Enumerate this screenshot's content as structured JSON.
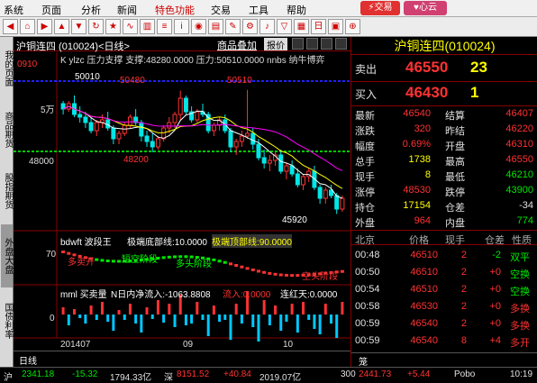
{
  "menu": [
    "系统",
    "页面",
    "分析",
    "新闻",
    "特色功能",
    "交易",
    "工具",
    "帮助"
  ],
  "toolbar": {
    "trade_btn": "交易",
    "phone_btn": "心云"
  },
  "sidetabs": [
    "我的页面",
    "商品期货",
    "股指期货",
    "外盘大盘",
    "国债利率"
  ],
  "chart": {
    "title": "沪铜连四 (010024)<日线>",
    "chip": "商品叠加",
    "report": "报价",
    "indicator_row": "K  ylzc 压力支撑 支撑:48280.0000 压力:50510.0000  nnbs 纳牛博弈",
    "price_labels": [
      "50480",
      "50510",
      "48200",
      "45920",
      "50010"
    ],
    "y_labels": [
      "5万",
      "48000",
      "70",
      "0"
    ],
    "sub1_title": "bdwft 波段王",
    "sub1_a": "极端底部线:10.0000",
    "sub1_b": "极端顶部线:90.0000",
    "sub1_tags": [
      "多卖开",
      "短空阶段",
      "多头阶段",
      "空头阶段"
    ],
    "sub2_title": "mml 买卖量",
    "sub2_a": "N日内净流入:-1063.8808",
    "sub2_b": "流入:0.0000",
    "sub2_c": "连红天:0.0000",
    "x_labels": [
      "201407",
      "09",
      "10"
    ],
    "tab": "日线"
  },
  "chart_data": {
    "type": "candlestick",
    "ylim": [
      45500,
      51500
    ],
    "ohlc": [
      [
        50000,
        50100,
        49600,
        49800
      ],
      [
        49800,
        50100,
        49700,
        50000
      ],
      [
        50000,
        50300,
        49500,
        49600
      ],
      [
        49600,
        49900,
        49300,
        49500
      ],
      [
        49500,
        49700,
        49100,
        49300
      ],
      [
        49300,
        49500,
        48900,
        49000
      ],
      [
        49000,
        49400,
        48800,
        49300
      ],
      [
        49300,
        49600,
        49100,
        49400
      ],
      [
        49400,
        49700,
        49000,
        49100
      ],
      [
        49100,
        49200,
        48500,
        48700
      ],
      [
        48700,
        49000,
        48500,
        48900
      ],
      [
        48900,
        49300,
        48800,
        49200
      ],
      [
        49200,
        49600,
        49100,
        49500
      ],
      [
        49500,
        49800,
        49200,
        49300
      ],
      [
        49300,
        49400,
        48600,
        48800
      ],
      [
        48800,
        49000,
        48400,
        48600
      ],
      [
        48600,
        48900,
        48200,
        48400
      ],
      [
        48400,
        48800,
        48300,
        48700
      ],
      [
        48700,
        49200,
        48600,
        49100
      ],
      [
        49100,
        49500,
        48900,
        49300
      ],
      [
        49300,
        49700,
        49100,
        49600
      ],
      [
        49600,
        50480,
        49400,
        50200
      ],
      [
        50200,
        50300,
        49600,
        49700
      ],
      [
        49700,
        49900,
        49300,
        49400
      ],
      [
        49400,
        49800,
        49300,
        49700
      ],
      [
        49700,
        50000,
        49500,
        49600
      ],
      [
        49600,
        49700,
        48900,
        49000
      ],
      [
        49000,
        49300,
        48800,
        49200
      ],
      [
        49200,
        49500,
        49000,
        49400
      ],
      [
        49400,
        49600,
        48900,
        49000
      ],
      [
        49000,
        49100,
        48200,
        48400
      ],
      [
        48400,
        48700,
        48100,
        48600
      ],
      [
        48600,
        49000,
        48400,
        48800
      ],
      [
        48800,
        50510,
        48700,
        48900
      ],
      [
        48900,
        49100,
        48300,
        48500
      ],
      [
        48500,
        48700,
        47900,
        48000
      ],
      [
        48000,
        48300,
        47600,
        47800
      ],
      [
        47800,
        48100,
        47500,
        47900
      ],
      [
        47900,
        48200,
        47700,
        48100
      ],
      [
        48100,
        48300,
        47400,
        47500
      ],
      [
        47500,
        47800,
        47200,
        47700
      ],
      [
        47700,
        47900,
        47300,
        47400
      ],
      [
        47400,
        47600,
        46900,
        47000
      ],
      [
        47000,
        47400,
        46800,
        47300
      ],
      [
        47300,
        47600,
        47100,
        47500
      ],
      [
        47500,
        47700,
        46800,
        46900
      ],
      [
        46900,
        47000,
        46300,
        46500
      ],
      [
        46500,
        46900,
        46300,
        46800
      ],
      [
        46800,
        47000,
        46500,
        46600
      ],
      [
        46600,
        46700,
        45920,
        46100
      ],
      [
        46100,
        46600,
        46000,
        46500
      ]
    ]
  },
  "panel": {
    "title": "沪铜连四(010024)",
    "ask": {
      "label": "卖出",
      "price": "46550",
      "vol": "23"
    },
    "bid": {
      "label": "买入",
      "price": "46430",
      "vol": "1"
    },
    "stats": [
      [
        "最新",
        "46540",
        "结算",
        "46407"
      ],
      [
        "涨跌",
        "320",
        "昨结",
        "46220"
      ],
      [
        "幅度",
        "0.69%",
        "开盘",
        "46310"
      ],
      [
        "总手",
        "1738",
        "最高",
        "46550"
      ],
      [
        "现手",
        "8",
        "最低",
        "46210"
      ],
      [
        "涨停",
        "48530",
        "跌停",
        "43900"
      ],
      [
        "持仓",
        "17154",
        "仓差",
        "-34"
      ],
      [
        "外盘",
        "964",
        "内盘",
        "774"
      ]
    ],
    "tick_headers": [
      "北京",
      "价格",
      "现手",
      "仓差",
      "性质"
    ],
    "ticks": [
      [
        "00:48",
        "46510",
        "2",
        "-2",
        "双平"
      ],
      [
        "00:50",
        "46510",
        "2",
        "+0",
        "空换"
      ],
      [
        "00:54",
        "46510",
        "2",
        "+0",
        "空换"
      ],
      [
        "00:58",
        "46530",
        "2",
        "+0",
        "多换"
      ],
      [
        "00:59",
        "46540",
        "2",
        "+0",
        "多换"
      ],
      [
        "00:59",
        "46540",
        "8",
        "+4",
        "多开"
      ]
    ],
    "tab": "笼"
  },
  "status": {
    "items": [
      "沪",
      "2341.18",
      "-15.32",
      "1794.33亿",
      "深",
      "8151.52",
      "+40.84",
      "2019.07亿",
      "300",
      "2441.73",
      "+5.44",
      "Pobo",
      "10:19"
    ]
  }
}
